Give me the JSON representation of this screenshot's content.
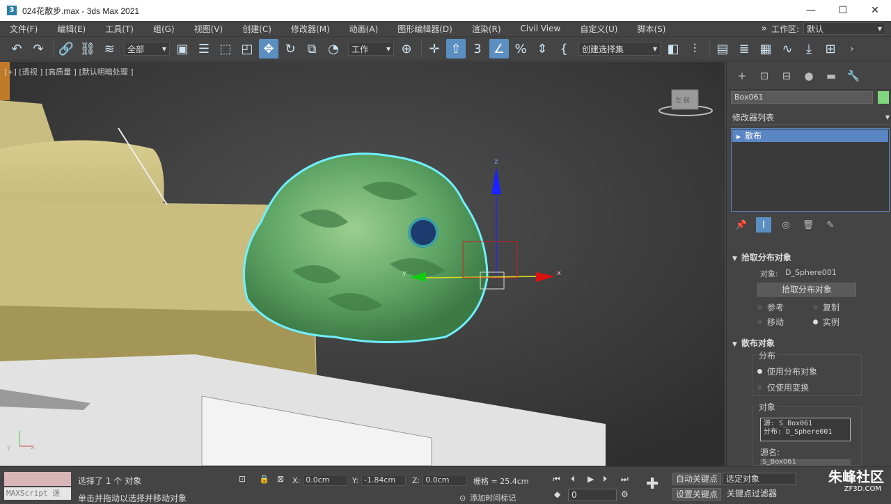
{
  "window": {
    "title": "024花散步.max - 3ds Max 2021",
    "app_icon": "3"
  },
  "menu": [
    "文件(F)",
    "编辑(E)",
    "工具(T)",
    "组(G)",
    "视图(V)",
    "创建(C)",
    "修改器(M)",
    "动画(A)",
    "图形编辑器(D)",
    "渲染(R)",
    "Civil View",
    "自定义(U)",
    "脚本(S)"
  ],
  "workspace": {
    "label": "工作区:",
    "value": "默认"
  },
  "toolbar": {
    "filter": "全部",
    "coord_system": "工作",
    "named_selection": "创建选择集"
  },
  "viewport": {
    "label": "[+] [透视 ] [高质量 ] [默认明暗处理 ]",
    "viewcube_text": "左  前",
    "axis_y": "y",
    "axis_x": "x",
    "gizmo_x": "x",
    "gizmo_y": "y",
    "gizmo_z": "z"
  },
  "command_panel": {
    "object_name": "Box061",
    "object_color": "#7fd67f",
    "modifier_list": "修改器列表",
    "stack_item": "散布",
    "pick_rollout": {
      "title": "拾取分布对象",
      "object_label": "对象:",
      "object_value": "D_Sphere001",
      "pick_button": "拾取分布对象",
      "radio_ref": "参考",
      "radio_copy": "复制",
      "radio_move": "移动",
      "radio_instance": "实例"
    },
    "scatter_rollout": {
      "title": "散布对象",
      "distribution_group": "分布",
      "use_dist": "使用分布对象",
      "transform_only": "仅使用变换",
      "objects_group": "对象",
      "list_line1": "源: S_Box061",
      "list_line2": "分布: D_Sphere001",
      "source_name_label": "源名:",
      "source_name_value": "S_Box061"
    }
  },
  "status": {
    "maxscript_hint": "MAXScript 迷",
    "selected": "选择了 1 个 对象",
    "hint": "单击并拖动以选择并移动对象",
    "x_label": "X:",
    "x_value": "0.0cm",
    "y_label": "Y:",
    "y_value": "-1.84cm",
    "z_label": "Z:",
    "z_value": "0.0cm",
    "grid": "栅格 = 25.4cm",
    "add_time_tag": "添加时间标记",
    "frame": "0",
    "auto_key": "自动关键点",
    "set_key": "设置关键点",
    "selected_objects": "选定对象",
    "key_filters": "关键点过滤器",
    "logo_main": "朱峰社区",
    "logo_sub": "ZF3D.COM"
  }
}
